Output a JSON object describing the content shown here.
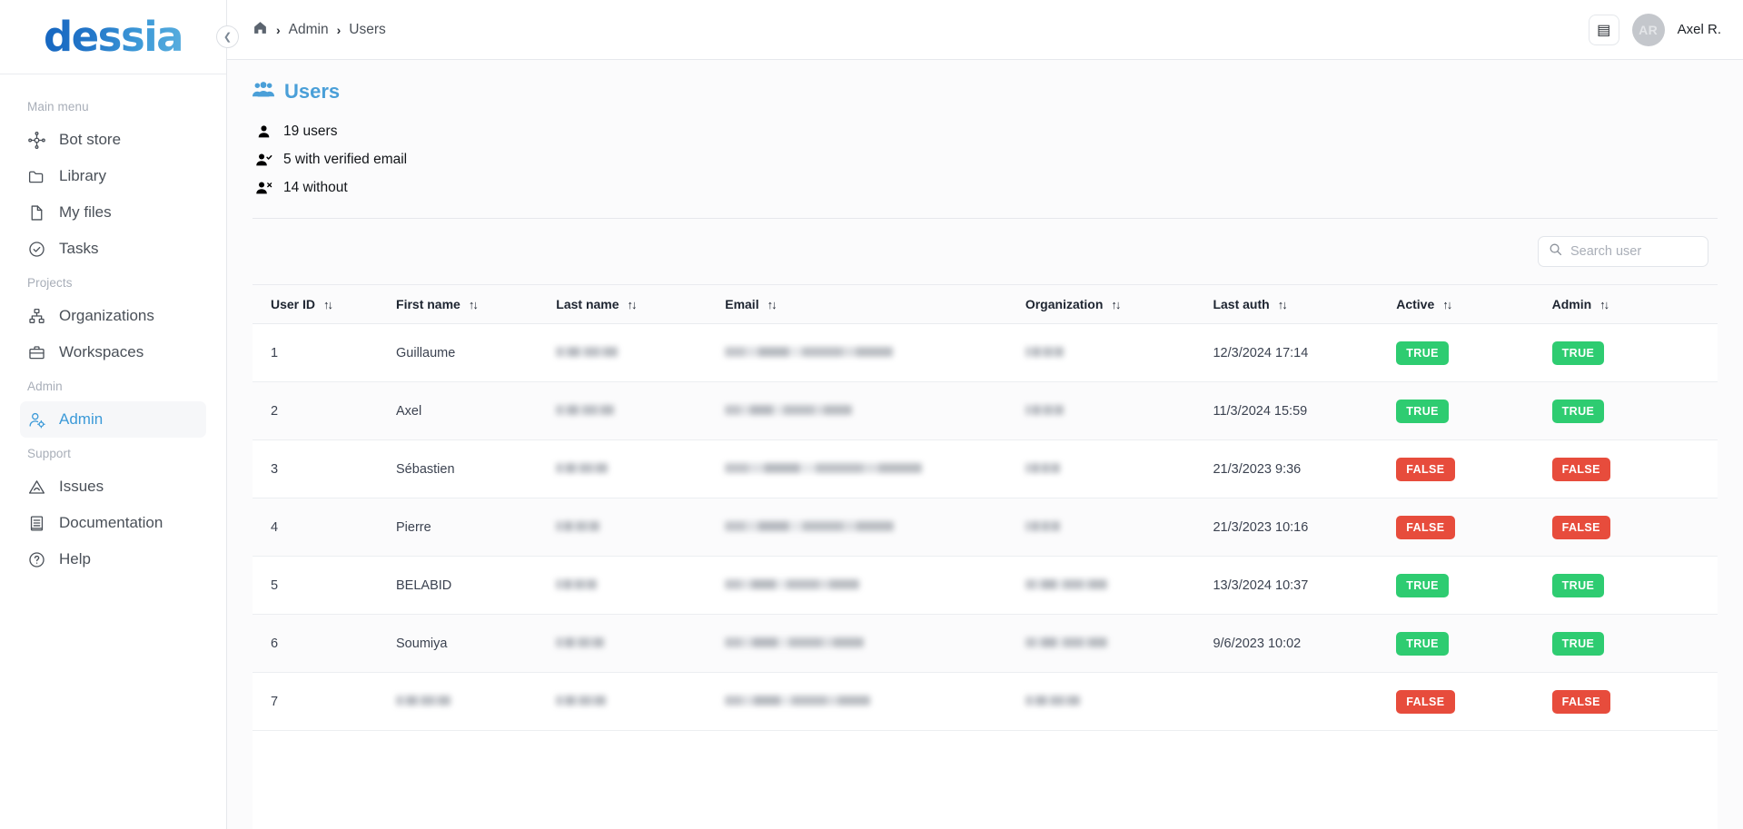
{
  "brand": {
    "name": "dessia"
  },
  "sidebar": {
    "collapse_icon": "chevron-left-icon",
    "groups": [
      {
        "label": "Main menu",
        "items": [
          {
            "label": "Bot store",
            "icon": "bot-store-icon",
            "active": false
          },
          {
            "label": "Library",
            "icon": "folder-icon",
            "active": false
          },
          {
            "label": "My files",
            "icon": "file-icon",
            "active": false
          },
          {
            "label": "Tasks",
            "icon": "check-circle-icon",
            "active": false
          }
        ]
      },
      {
        "label": "Projects",
        "items": [
          {
            "label": "Organizations",
            "icon": "org-chart-icon",
            "active": false
          },
          {
            "label": "Workspaces",
            "icon": "briefcase-icon",
            "active": false
          }
        ]
      },
      {
        "label": "Admin",
        "items": [
          {
            "label": "Admin",
            "icon": "user-gear-icon",
            "active": true
          }
        ]
      },
      {
        "label": "Support",
        "items": [
          {
            "label": "Issues",
            "icon": "warning-triangle-icon",
            "active": false
          },
          {
            "label": "Documentation",
            "icon": "book-icon",
            "active": false
          },
          {
            "label": "Help",
            "icon": "question-circle-icon",
            "active": false
          }
        ]
      }
    ]
  },
  "topbar": {
    "breadcrumb": {
      "home_icon": "home-icon",
      "separator": "›",
      "items": [
        "Admin",
        "Users"
      ]
    },
    "doc_button_icon": "book-icon",
    "avatar_initials": "AR",
    "username": "Axel R."
  },
  "page": {
    "title": "Users",
    "title_icon": "users-group-icon",
    "stats": [
      {
        "icon": "user-icon",
        "text": "19 users"
      },
      {
        "icon": "user-check-icon",
        "text": "5 with verified email"
      },
      {
        "icon": "user-x-icon",
        "text": "14 without"
      }
    ]
  },
  "search": {
    "icon": "search-icon",
    "placeholder": "Search user",
    "value": ""
  },
  "table": {
    "sort_icon": "sort-arrows-icon",
    "columns": [
      {
        "key": "user_id",
        "label": "User ID"
      },
      {
        "key": "first_name",
        "label": "First name"
      },
      {
        "key": "last_name",
        "label": "Last name"
      },
      {
        "key": "email",
        "label": "Email"
      },
      {
        "key": "organization",
        "label": "Organization"
      },
      {
        "key": "last_auth",
        "label": "Last auth"
      },
      {
        "key": "active",
        "label": "Active"
      },
      {
        "key": "admin",
        "label": "Admin"
      }
    ],
    "rows": [
      {
        "user_id": "1",
        "first_name": "Guillaume",
        "last_name": "",
        "last_name_redacted": true,
        "last_name_w": 68,
        "email": "",
        "email_redacted": true,
        "email_w": 185,
        "organization": "",
        "organization_redacted": true,
        "organization_w": 42,
        "last_auth": "12/3/2024 17:14",
        "active": "TRUE",
        "admin": "TRUE"
      },
      {
        "user_id": "2",
        "first_name": "Axel",
        "last_name": "",
        "last_name_redacted": true,
        "last_name_w": 64,
        "email": "",
        "email_redacted": true,
        "email_w": 140,
        "organization": "",
        "organization_redacted": true,
        "organization_w": 42,
        "last_auth": "11/3/2024 15:59",
        "active": "TRUE",
        "admin": "TRUE"
      },
      {
        "user_id": "3",
        "first_name": "Sébastien",
        "last_name": "",
        "last_name_redacted": true,
        "last_name_w": 57,
        "email": "",
        "email_redacted": true,
        "email_w": 217,
        "organization": "",
        "organization_redacted": true,
        "organization_w": 38,
        "last_auth": "21/3/2023 9:36",
        "active": "FALSE",
        "admin": "FALSE"
      },
      {
        "user_id": "4",
        "first_name": "Pierre",
        "last_name": "",
        "last_name_redacted": true,
        "last_name_w": 48,
        "email": "",
        "email_redacted": true,
        "email_w": 186,
        "organization": "",
        "organization_redacted": true,
        "organization_w": 38,
        "last_auth": "21/3/2023 10:16",
        "active": "FALSE",
        "admin": "FALSE"
      },
      {
        "user_id": "5",
        "first_name": "BELABID",
        "last_name": "",
        "last_name_redacted": true,
        "last_name_w": 45,
        "email": "",
        "email_redacted": true,
        "email_w": 148,
        "organization": "",
        "organization_redacted": true,
        "organization_w": 90,
        "last_auth": "13/3/2024 10:37",
        "active": "TRUE",
        "admin": "TRUE"
      },
      {
        "user_id": "6",
        "first_name": "Soumiya",
        "last_name": "",
        "last_name_redacted": true,
        "last_name_w": 53,
        "email": "",
        "email_redacted": true,
        "email_w": 153,
        "organization": "",
        "organization_redacted": true,
        "organization_w": 90,
        "last_auth": "9/6/2023 10:02",
        "active": "TRUE",
        "admin": "TRUE"
      },
      {
        "user_id": "7",
        "first_name": "",
        "first_name_redacted": true,
        "first_name_w": 60,
        "last_name": "",
        "last_name_redacted": true,
        "last_name_w": 55,
        "email": "",
        "email_redacted": true,
        "email_w": 160,
        "organization": "",
        "organization_redacted": true,
        "organization_w": 60,
        "last_auth": "",
        "active": "FALSE",
        "admin": "FALSE"
      }
    ]
  },
  "colors": {
    "accent": "#4a9fd8",
    "true_badge": "#2ecc71",
    "false_badge": "#e74c3c",
    "content_bg": "#fbfbfc",
    "border": "#e6e8ec"
  }
}
